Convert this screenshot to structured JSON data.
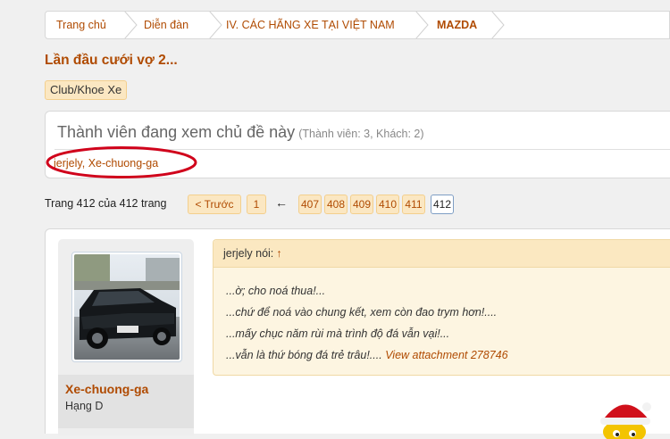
{
  "breadcrumb": {
    "items": [
      "Trang chủ",
      "Diễn đàn",
      "IV. CÁC HÃNG XE TẠI VIỆT NAM",
      "MAZDA"
    ]
  },
  "thread": {
    "title": "Lần đầu cưới vợ 2...",
    "prefix": "Club/Khoe Xe"
  },
  "viewers": {
    "title": "Thành viên đang xem chủ đề này",
    "count": "(Thành viên: 3, Khách: 2)",
    "members": [
      "jerjely",
      "Xe-chuong-ga"
    ],
    "separator": ", "
  },
  "pagination": {
    "label": "Trang 412 của 412 trang",
    "prev": "< Trước",
    "first": "1",
    "ellipsis_arrow": "←",
    "pages": [
      "407",
      "408",
      "409",
      "410",
      "411",
      "412"
    ],
    "current": "412"
  },
  "post": {
    "author": "Xe-chuong-ga",
    "rank": "Hạng D",
    "quote": {
      "author_line": "jerjely nói:",
      "arrow": "↑",
      "lines": [
        "...ờ; cho noá thua!...",
        "...chứ để noá vào chung kết, xem còn đao trym hơn!....",
        "...mấy chục năm rùi mà trình độ đá vẫn vại!...",
        "...vẫn là thứ bóng đá trẻ trâu!...."
      ],
      "attachment": "View attachment 278746"
    }
  },
  "colors": {
    "link": "#b04b02",
    "annotation": "#d0021b",
    "tag_bg": "#fbe7c2"
  }
}
